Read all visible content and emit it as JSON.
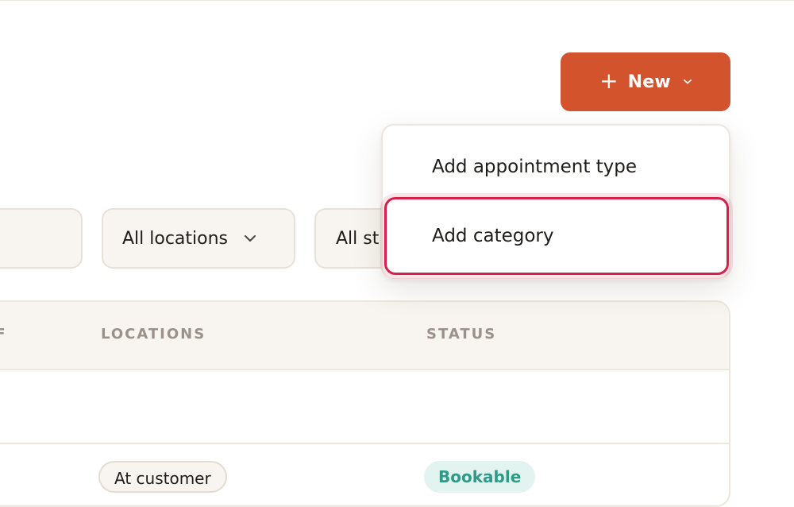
{
  "header": {
    "new_button": {
      "icon": "plus-icon",
      "label": "New",
      "chevron": "chevron-down-icon",
      "color": "#d2532c"
    }
  },
  "dropdown": {
    "items": [
      {
        "label": "Add appointment type"
      },
      {
        "label": "Add category",
        "state": "focused"
      }
    ],
    "focus_color": "#d6204a"
  },
  "filters": {
    "search": {
      "value": ""
    },
    "locations": {
      "label": "All locations",
      "chevron": "chevron-down-icon"
    },
    "status": {
      "label": "All st"
    }
  },
  "table": {
    "columns": [
      "FF",
      "LOCATIONS",
      "STATUS"
    ],
    "rows": [
      {
        "location": "At customer",
        "status": "Bookable"
      }
    ],
    "status_color": "#2f9b86"
  }
}
